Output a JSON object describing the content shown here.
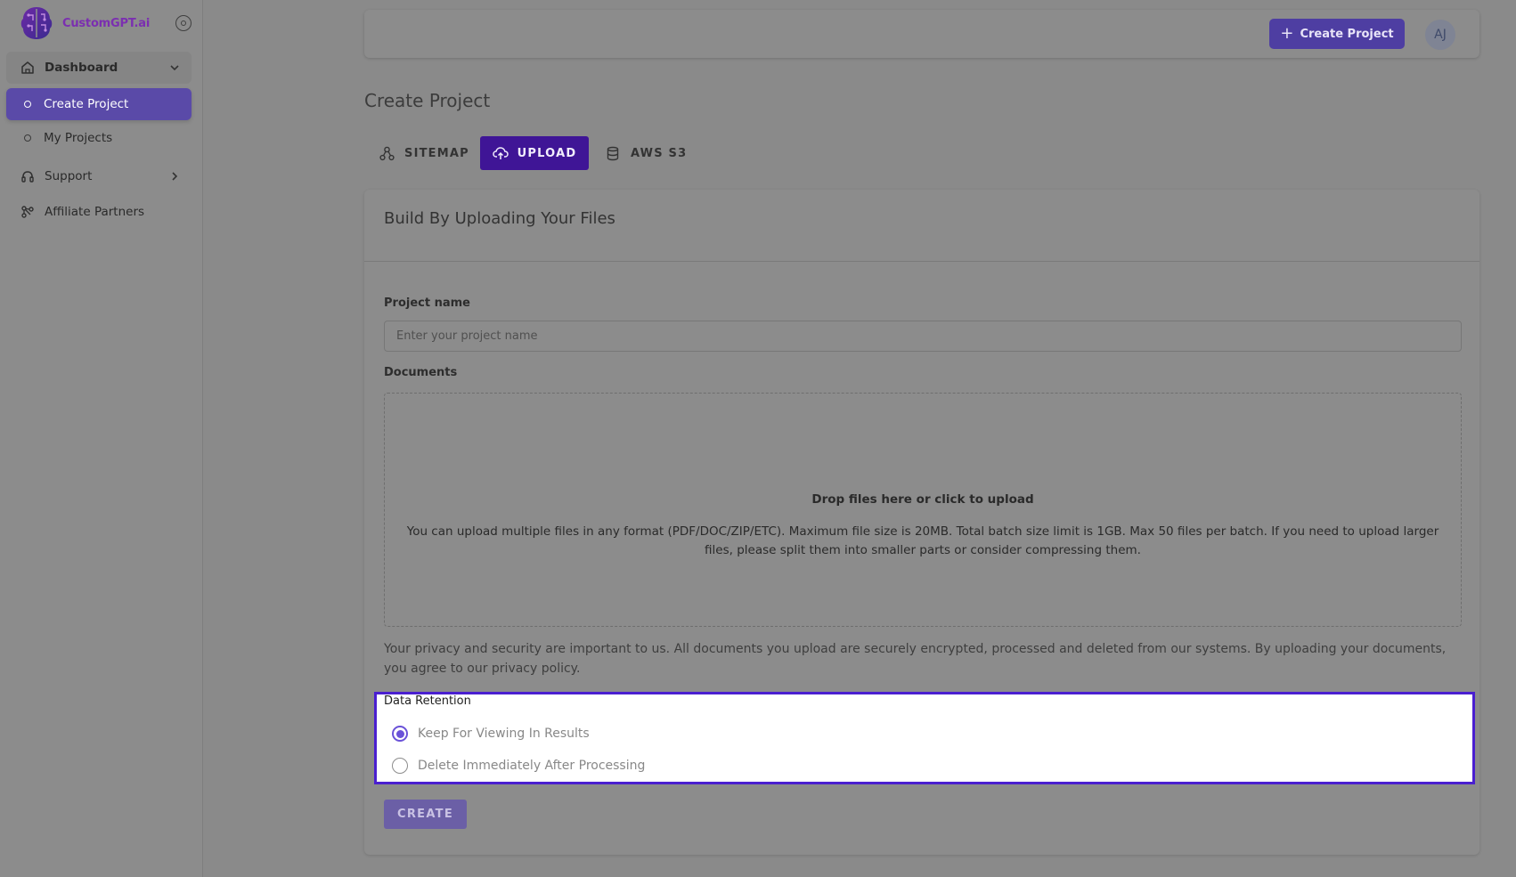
{
  "brand": {
    "name": "CustomGPT.ai"
  },
  "sidebar": {
    "items": [
      {
        "label": "Dashboard",
        "icon": "home-icon"
      },
      {
        "label": "Create Project",
        "icon": "circle-bullet-icon",
        "active": true
      },
      {
        "label": "My Projects",
        "icon": "circle-bullet-icon"
      },
      {
        "label": "Support",
        "icon": "headset-icon"
      },
      {
        "label": "Affiliate Partners",
        "icon": "share-nodes-icon"
      }
    ]
  },
  "header": {
    "create_button_label": "Create Project",
    "avatar_initials": "AJ"
  },
  "page": {
    "title": "Create Project"
  },
  "tabs": [
    {
      "label": "SITEMAP",
      "icon": "sitemap-icon"
    },
    {
      "label": "UPLOAD",
      "icon": "cloud-upload-icon",
      "active": true
    },
    {
      "label": "AWS S3",
      "icon": "database-icon"
    }
  ],
  "form": {
    "card_title": "Build By Uploading Your Files",
    "project_name_label": "Project name",
    "project_name_placeholder": "Enter your project name",
    "project_name_value": "",
    "documents_label": "Documents",
    "dropzone_title": "Drop files here or click to upload",
    "dropzone_description": "You can upload multiple files in any format (PDF/DOC/ZIP/ETC). Maximum file size is 20MB. Total batch size limit is 1GB. Max 50 files per batch. If you need to upload larger files, please split them into smaller parts or consider compressing them.",
    "privacy_notice": "Your privacy and security are important to us. All documents you upload are securely encrypted, processed and deleted from our systems. By uploading your documents, you agree to our privacy policy.",
    "retention": {
      "title": "Data Retention",
      "options": [
        {
          "label": "Keep For Viewing In Results",
          "selected": true
        },
        {
          "label": "Delete Immediately After Processing",
          "selected": false
        }
      ]
    },
    "submit_label": "CREATE"
  },
  "colors": {
    "accent": "#4e3ea2",
    "active_tab": "#3f1596",
    "highlight_border": "#4a1fd0",
    "radio_selected": "#6a52d8",
    "brand_text": "#7b2fb0"
  }
}
